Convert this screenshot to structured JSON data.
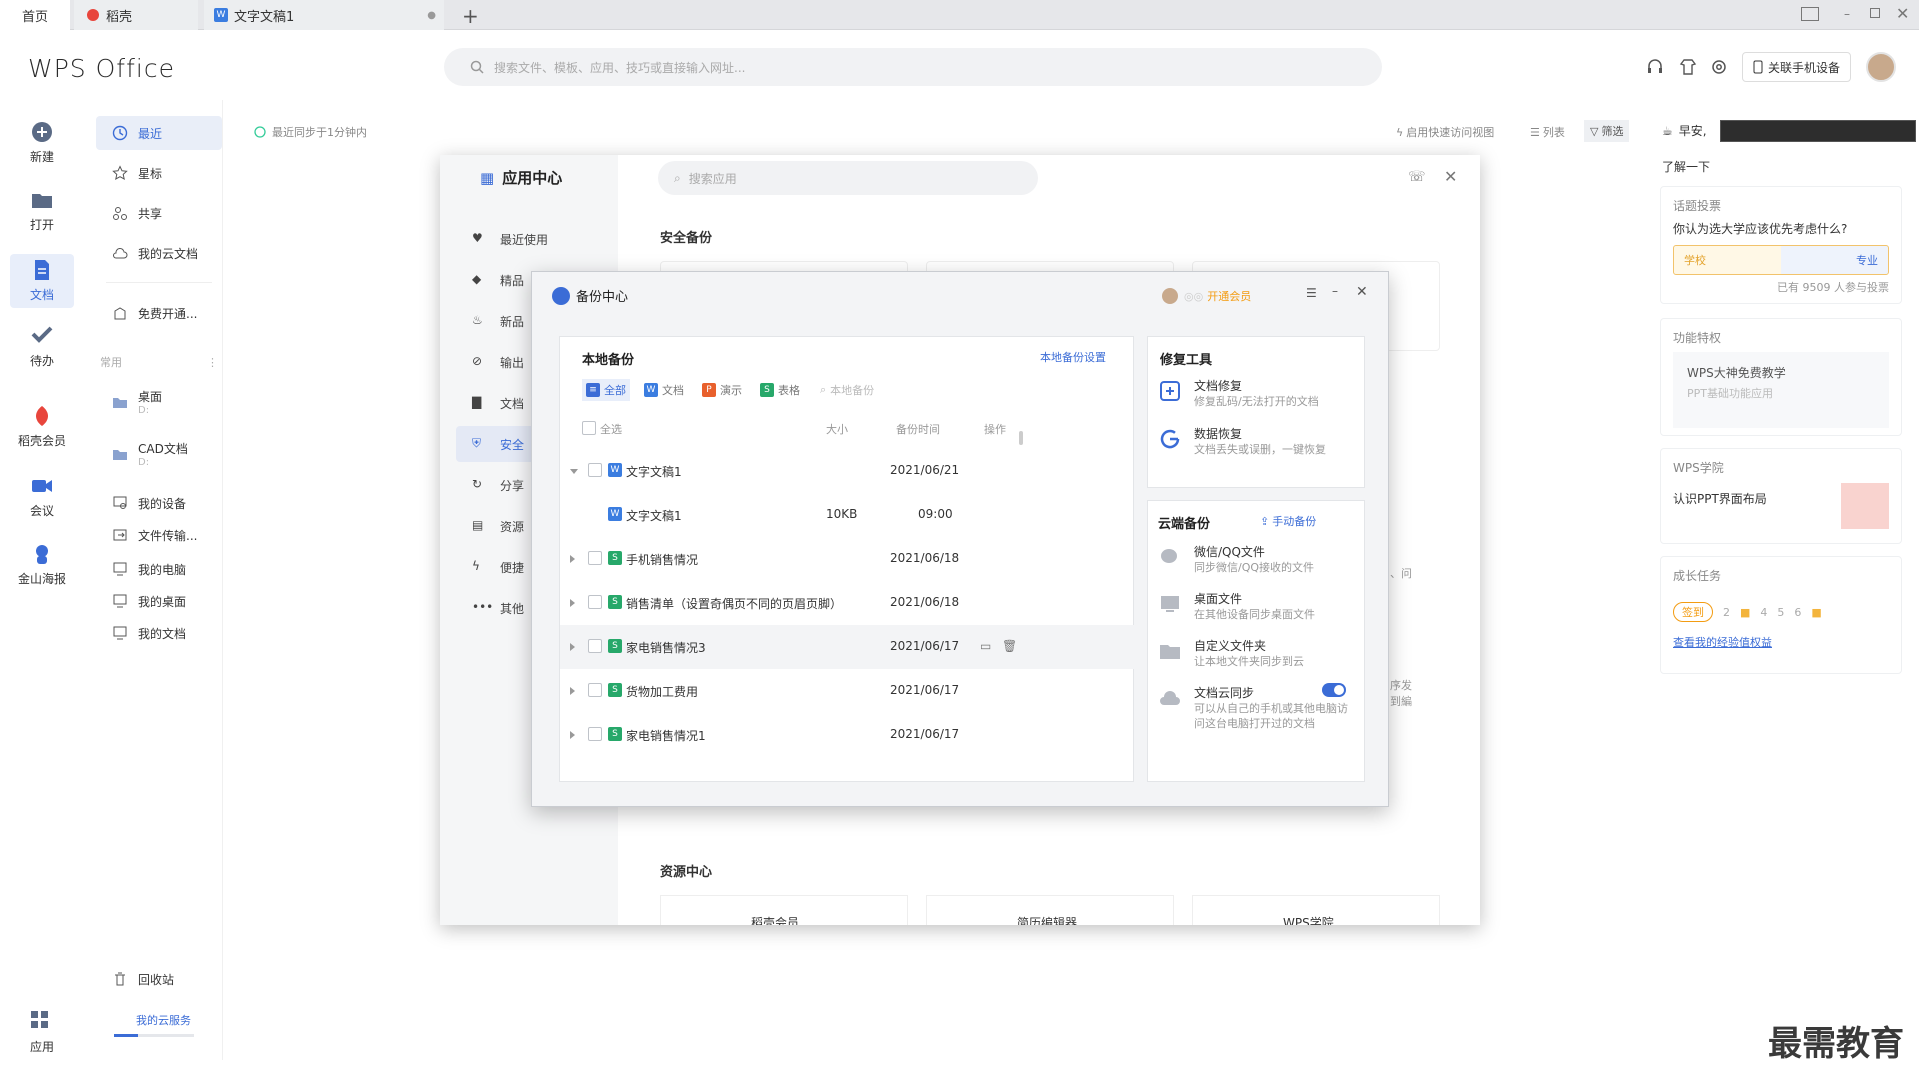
{
  "tabs": {
    "home": "首页",
    "daoke": "稻壳",
    "doc": "文字文稿1"
  },
  "header": {
    "logo": "WPS Office",
    "search_placeholder": "搜索文件、模板、应用、技巧或直接输入网址...",
    "link_phone": "关联手机设备"
  },
  "rail": {
    "new": "新建",
    "open": "打开",
    "docs": "文档",
    "todo": "待办",
    "daoke": "稻壳会员",
    "meeting": "会议",
    "poster": "金山海报",
    "apps": "应用"
  },
  "sidebar": {
    "recent": "最近",
    "star": "星标",
    "share": "共享",
    "cloud": "我的云文档",
    "free": "免费开通...",
    "common_label": "常用",
    "desktop": "桌面",
    "desktop_path": "D:",
    "cad": "CAD文档",
    "cad_path": "D:",
    "device": "我的设备",
    "transfer": "文件传输...",
    "pc": "我的电脑",
    "my_desktop": "我的桌面",
    "my_docs": "我的文档",
    "recycle": "回收站",
    "cloud_service": "我的云服务"
  },
  "main": {
    "sync_status": "最近同步于1分钟内",
    "quick_view": "启用快速访问视图",
    "list": "列表",
    "filter": "筛选"
  },
  "right": {
    "greeting": "早安,",
    "learn": "了解一下",
    "vote_title": "话题投票",
    "vote_question": "你认为选大学应该优先考虑什么?",
    "vote_a": "学校",
    "vote_b": "专业",
    "vote_count": "已有 9509 人参与投票",
    "feature_title": "功能特权",
    "feature_name": "WPS大神免费教学",
    "feature_sub": "PPT基础功能应用",
    "academy_title": "WPS学院",
    "academy_item": "认识PPT界面布局",
    "growth_title": "成长任务",
    "checkin": "签到",
    "days": [
      "2",
      "4",
      "5",
      "6"
    ],
    "growth_link": "查看我的经验值权益"
  },
  "appcenter": {
    "title": "应用中心",
    "search_placeholder": "搜索应用",
    "menu": [
      "最近使用",
      "精品",
      "新品",
      "输出",
      "文档",
      "安全",
      "分享",
      "资源",
      "便捷",
      "其他"
    ],
    "section_security": "安全备份",
    "section_resource": "资源中心",
    "resource_items": [
      "稻壳会员",
      "简历编辑器",
      "WPS学院"
    ],
    "partial_right": [
      "、问",
      "序发",
      "到編"
    ]
  },
  "backup": {
    "title": "备份中心",
    "vip": "开通会员",
    "local_title": "本地备份",
    "local_settings": "本地备份设置",
    "filters": [
      "全部",
      "文档",
      "演示",
      "表格"
    ],
    "filter_search": "本地备份",
    "col_all": "全选",
    "col_size": "大小",
    "col_time": "备份时间",
    "col_op": "操作",
    "rows": [
      {
        "name": "文字文稿1",
        "time": "2021/06/21",
        "type": "doc"
      },
      {
        "name": "文字文稿1",
        "size": "10KB",
        "time": "09:00",
        "type": "doc"
      },
      {
        "name": "手机销售情况",
        "time": "2021/06/18",
        "type": "sheet"
      },
      {
        "name": "销售清单（设置奇偶页不同的页眉页脚）",
        "time": "2021/06/18",
        "type": "sheet"
      },
      {
        "name": "家电销售情况3",
        "time": "2021/06/17",
        "type": "sheet"
      },
      {
        "name": "货物加工费用",
        "time": "2021/06/17",
        "type": "sheet"
      },
      {
        "name": "家电销售情况1",
        "time": "2021/06/17",
        "type": "sheet"
      }
    ],
    "repair_title": "修复工具",
    "repair_items": [
      {
        "t": "文档修复",
        "s": "修复乱码/无法打开的文档"
      },
      {
        "t": "数据恢复",
        "s": "文档丢失或误删，一键恢复"
      }
    ],
    "cloud_title": "云端备份",
    "cloud_manual": "手动备份",
    "cloud_items": [
      {
        "t": "微信/QQ文件",
        "s": "同步微信/QQ接收的文件"
      },
      {
        "t": "桌面文件",
        "s": "在其他设备同步桌面文件"
      },
      {
        "t": "自定义文件夹",
        "s": "让本地文件夹同步到云"
      },
      {
        "t": "文档云同步",
        "s": "可以从自己的手机或其他电脑访问这台电脑打开过的文档"
      }
    ]
  },
  "watermark": "最需教育",
  "colors": {
    "accent": "#3b6cd6",
    "vip": "#f39c12",
    "tab_bg": "#e6e7ea"
  }
}
